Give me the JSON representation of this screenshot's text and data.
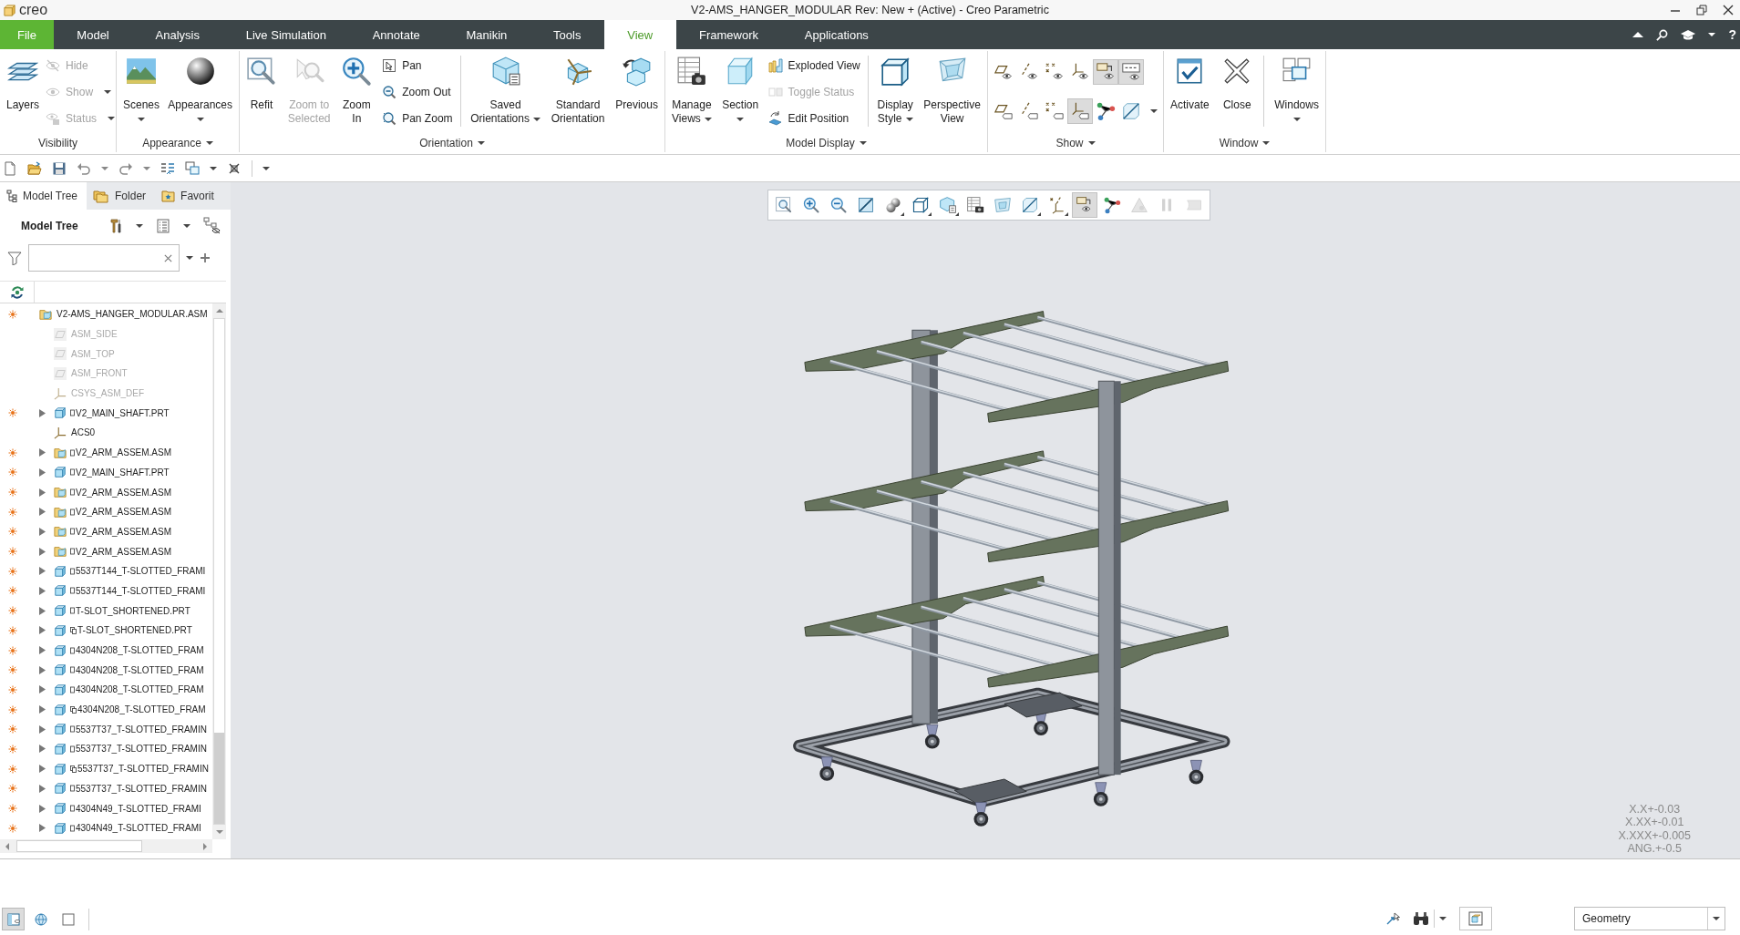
{
  "title_bar": {
    "logo_text": "creo",
    "title": "V2-AMS_HANGER_MODULAR Rev: New + (Active) - Creo Parametric"
  },
  "ribbon_bar": {
    "tabs": [
      {
        "label": "File",
        "kind": "file",
        "selected": false
      },
      {
        "label": "Model",
        "kind": "tab",
        "selected": false
      },
      {
        "label": "Analysis",
        "kind": "tab",
        "selected": false
      },
      {
        "label": "Live Simulation",
        "kind": "tab",
        "selected": false
      },
      {
        "label": "Annotate",
        "kind": "tab",
        "selected": false
      },
      {
        "label": "Manikin",
        "kind": "tab",
        "selected": false
      },
      {
        "label": "Tools",
        "kind": "tab",
        "selected": false
      },
      {
        "label": "View",
        "kind": "tab",
        "selected": true
      },
      {
        "label": "Framework",
        "kind": "tab",
        "selected": false
      },
      {
        "label": "Applications",
        "kind": "tab",
        "selected": false
      }
    ],
    "help": "?"
  },
  "ribbon_groups": [
    {
      "label": "Visibility",
      "menu": false,
      "items": [
        {
          "kind": "large",
          "label": "Layers",
          "menu": false,
          "disabled": false
        },
        {
          "kind": "stack",
          "items": [
            {
              "label": "Hide",
              "menu": false,
              "disabled": true
            },
            {
              "label": "Show",
              "menu": true,
              "disabled": true
            },
            {
              "label": "Status",
              "menu": true,
              "disabled": true
            }
          ]
        }
      ]
    },
    {
      "label": "Appearance",
      "menu": true,
      "items": [
        {
          "kind": "large",
          "label": "Scenes",
          "menu": true,
          "disabled": false
        },
        {
          "kind": "large",
          "label": "Appearances",
          "menu": true,
          "disabled": false
        }
      ]
    },
    {
      "label": "Orientation",
      "menu": true,
      "items": [
        {
          "kind": "large",
          "label": "Refit",
          "menu": false,
          "disabled": false
        },
        {
          "kind": "large",
          "label": "Zoom to Selected",
          "menu": false,
          "disabled": true
        },
        {
          "kind": "large",
          "label": "Zoom In",
          "menu": false,
          "disabled": false
        },
        {
          "kind": "stack",
          "items": [
            {
              "label": "Pan",
              "menu": false,
              "disabled": false
            },
            {
              "label": "Zoom Out",
              "menu": false,
              "disabled": false
            },
            {
              "label": "Pan Zoom",
              "menu": false,
              "disabled": false
            }
          ]
        },
        {
          "kind": "separator"
        },
        {
          "kind": "large",
          "label": "Saved Orientations",
          "menu": true,
          "disabled": false
        },
        {
          "kind": "large",
          "label": "Standard Orientation",
          "menu": false,
          "disabled": false
        },
        {
          "kind": "large",
          "label": "Previous",
          "menu": false,
          "disabled": false
        }
      ]
    },
    {
      "label": "Model Display",
      "menu": true,
      "items": [
        {
          "kind": "large",
          "label": "Manage Views",
          "menu": true,
          "disabled": false
        },
        {
          "kind": "large",
          "label": "Section",
          "menu": true,
          "disabled": false
        },
        {
          "kind": "stack",
          "items": [
            {
              "label": "Exploded View",
              "menu": false,
              "disabled": false
            },
            {
              "label": "Toggle Status",
              "menu": false,
              "disabled": true
            },
            {
              "label": "Edit Position",
              "menu": false,
              "disabled": false
            }
          ]
        },
        {
          "kind": "separator"
        },
        {
          "kind": "large",
          "label": "Display Style",
          "menu": true,
          "disabled": false
        },
        {
          "kind": "large",
          "label": "Perspective View",
          "menu": false,
          "disabled": false
        }
      ]
    },
    {
      "label": "Show",
      "menu": true,
      "items": [
        {
          "kind": "grid",
          "menu": true,
          "toggles": [
            {
              "on": false
            },
            {
              "on": false
            },
            {
              "on": false
            },
            {
              "on": false
            },
            {
              "on": true
            },
            {
              "on": true
            },
            {
              "on": false
            },
            {
              "on": false
            },
            {
              "on": false
            },
            {
              "on": true
            },
            {
              "on": false
            },
            {
              "on": false
            }
          ]
        }
      ]
    },
    {
      "label": "Window",
      "menu": true,
      "items": [
        {
          "kind": "large",
          "label": "Activate",
          "menu": false,
          "disabled": false
        },
        {
          "kind": "large",
          "label": "Close",
          "menu": false,
          "disabled": false
        },
        {
          "kind": "separator"
        },
        {
          "kind": "large",
          "label": "Windows",
          "menu": true,
          "disabled": false
        }
      ]
    }
  ],
  "model_tree": {
    "tabs": [
      {
        "label": "Model Tree",
        "selected": true
      },
      {
        "label": "Folder",
        "selected": false
      },
      {
        "label": "Favorit",
        "selected": false
      }
    ],
    "title": "Model Tree",
    "items": [
      {
        "name": "V2-AMS_HANGER_MODULAR.ASM",
        "kind": "assembly",
        "status": true,
        "hidden": false,
        "children": [
          {
            "name": "ASM_SIDE",
            "kind": "plane",
            "status": false,
            "hidden": true
          },
          {
            "name": "ASM_TOP",
            "kind": "plane",
            "status": false,
            "hidden": true
          },
          {
            "name": "ASM_FRONT",
            "kind": "plane",
            "status": false,
            "hidden": true
          },
          {
            "name": "CSYS_ASM_DEF",
            "kind": "csys",
            "status": false,
            "hidden": true
          },
          {
            "name": "V2_MAIN_SHAFT.PRT",
            "kind": "part",
            "stacked_marker": false,
            "status": true,
            "hidden": false,
            "expanded": false
          },
          {
            "name": "ACS0",
            "kind": "csys",
            "status": false,
            "hidden": false
          },
          {
            "name": "V2_ARM_ASSEM.ASM",
            "kind": "assembly",
            "stacked_marker": false,
            "status": true,
            "hidden": false,
            "expanded": false
          },
          {
            "name": "V2_MAIN_SHAFT.PRT",
            "kind": "part",
            "stacked_marker": false,
            "status": true,
            "hidden": false,
            "expanded": false
          },
          {
            "name": "V2_ARM_ASSEM.ASM",
            "kind": "assembly",
            "stacked_marker": false,
            "status": true,
            "hidden": false,
            "expanded": false
          },
          {
            "name": "V2_ARM_ASSEM.ASM",
            "kind": "assembly",
            "stacked_marker": false,
            "status": true,
            "hidden": false,
            "expanded": false
          },
          {
            "name": "V2_ARM_ASSEM.ASM",
            "kind": "assembly",
            "stacked_marker": false,
            "status": true,
            "hidden": false,
            "expanded": false
          },
          {
            "name": "V2_ARM_ASSEM.ASM",
            "kind": "assembly",
            "stacked_marker": false,
            "status": true,
            "hidden": false,
            "expanded": false
          },
          {
            "name": "5537T144_T-SLOTTED_FRAMI",
            "kind": "part",
            "stacked_marker": false,
            "status": true,
            "hidden": false,
            "expanded": false
          },
          {
            "name": "5537T144_T-SLOTTED_FRAMI",
            "kind": "part",
            "stacked_marker": false,
            "status": true,
            "hidden": false,
            "expanded": false
          },
          {
            "name": "T-SLOT_SHORTENED.PRT",
            "kind": "part",
            "stacked_marker": false,
            "status": true,
            "hidden": false,
            "expanded": false
          },
          {
            "name": "T-SLOT_SHORTENED.PRT",
            "kind": "part",
            "stacked_marker": true,
            "status": true,
            "hidden": false,
            "expanded": false
          },
          {
            "name": "4304N208_T-SLOTTED_FRAM",
            "kind": "part",
            "stacked_marker": false,
            "status": true,
            "hidden": false,
            "expanded": false
          },
          {
            "name": "4304N208_T-SLOTTED_FRAM",
            "kind": "part",
            "stacked_marker": false,
            "status": true,
            "hidden": false,
            "expanded": false
          },
          {
            "name": "4304N208_T-SLOTTED_FRAM",
            "kind": "part",
            "stacked_marker": false,
            "status": true,
            "hidden": false,
            "expanded": false
          },
          {
            "name": "4304N208_T-SLOTTED_FRAM",
            "kind": "part",
            "stacked_marker": true,
            "status": true,
            "hidden": false,
            "expanded": false
          },
          {
            "name": "5537T37_T-SLOTTED_FRAMIN",
            "kind": "part",
            "stacked_marker": false,
            "status": true,
            "hidden": false,
            "expanded": false
          },
          {
            "name": "5537T37_T-SLOTTED_FRAMIN",
            "kind": "part",
            "stacked_marker": false,
            "status": true,
            "hidden": false,
            "expanded": false
          },
          {
            "name": "5537T37_T-SLOTTED_FRAMIN",
            "kind": "part",
            "stacked_marker": true,
            "status": true,
            "hidden": false,
            "expanded": false
          },
          {
            "name": "5537T37_T-SLOTTED_FRAMIN",
            "kind": "part",
            "stacked_marker": false,
            "status": true,
            "hidden": false,
            "expanded": false
          },
          {
            "name": "4304N49_T-SLOTTED_FRAMI",
            "kind": "part",
            "stacked_marker": false,
            "status": true,
            "hidden": false,
            "expanded": false
          },
          {
            "name": "4304N49_T-SLOTTED_FRAMI",
            "kind": "part",
            "stacked_marker": false,
            "status": true,
            "hidden": false,
            "expanded": false
          }
        ]
      }
    ]
  },
  "graphics_toolbar": [
    {
      "on": false,
      "disabled": false,
      "menu": false
    },
    {
      "on": false,
      "disabled": false,
      "menu": false
    },
    {
      "on": false,
      "disabled": false,
      "menu": false
    },
    {
      "on": false,
      "disabled": false,
      "menu": false
    },
    {
      "on": false,
      "disabled": false,
      "menu": true
    },
    {
      "on": false,
      "disabled": false,
      "menu": true
    },
    {
      "on": false,
      "disabled": false,
      "menu": true
    },
    {
      "on": false,
      "disabled": false,
      "menu": false
    },
    {
      "on": false,
      "disabled": false,
      "menu": false
    },
    {
      "on": false,
      "disabled": false,
      "menu": true
    },
    {
      "on": false,
      "disabled": false,
      "menu": true
    },
    {
      "on": true,
      "disabled": false,
      "menu": false
    },
    {
      "on": false,
      "disabled": false,
      "menu": false
    },
    {
      "on": false,
      "disabled": true,
      "menu": false
    },
    {
      "on": false,
      "disabled": true,
      "menu": false
    },
    {
      "on": false,
      "disabled": true,
      "menu": false
    }
  ],
  "tolerance_notes": [
    "X.X+-0.03",
    "X.XX+-0.01",
    "X.XXX+-0.005",
    "ANG.+-0.5"
  ],
  "status_bar": {
    "toggles": [
      {
        "on": true
      },
      {
        "on": false
      },
      {
        "on": false
      }
    ],
    "selection_filter": "Geometry"
  }
}
